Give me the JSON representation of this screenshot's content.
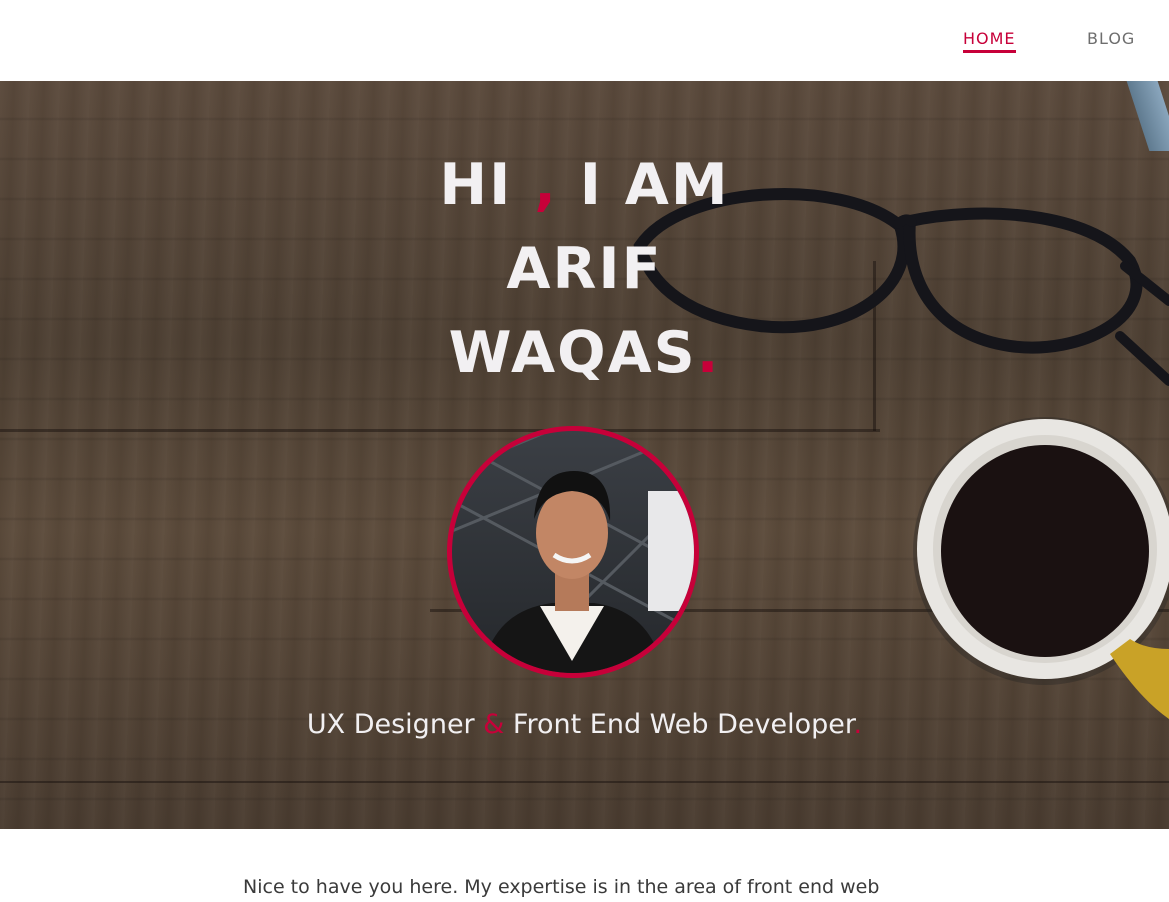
{
  "nav": {
    "home_label": "HOME",
    "blog_label": "BLOG"
  },
  "hero": {
    "greeting": "HI",
    "comma": ",",
    "i_am": "I AM",
    "first_name": "ARIF",
    "last_name": "WAQAS",
    "name_period": ".",
    "tagline_role1": "UX Designer",
    "tagline_amp": "&",
    "tagline_role2": "Front End Web Developer",
    "tagline_period": "."
  },
  "intro": {
    "text": "Nice to have you here. My expertise is in the area of front end web"
  },
  "colors": {
    "accent": "#c70039",
    "hero_text": "#f2f0f2",
    "nav_inactive": "#6e6e6e",
    "body_text": "#3a3a3a"
  }
}
